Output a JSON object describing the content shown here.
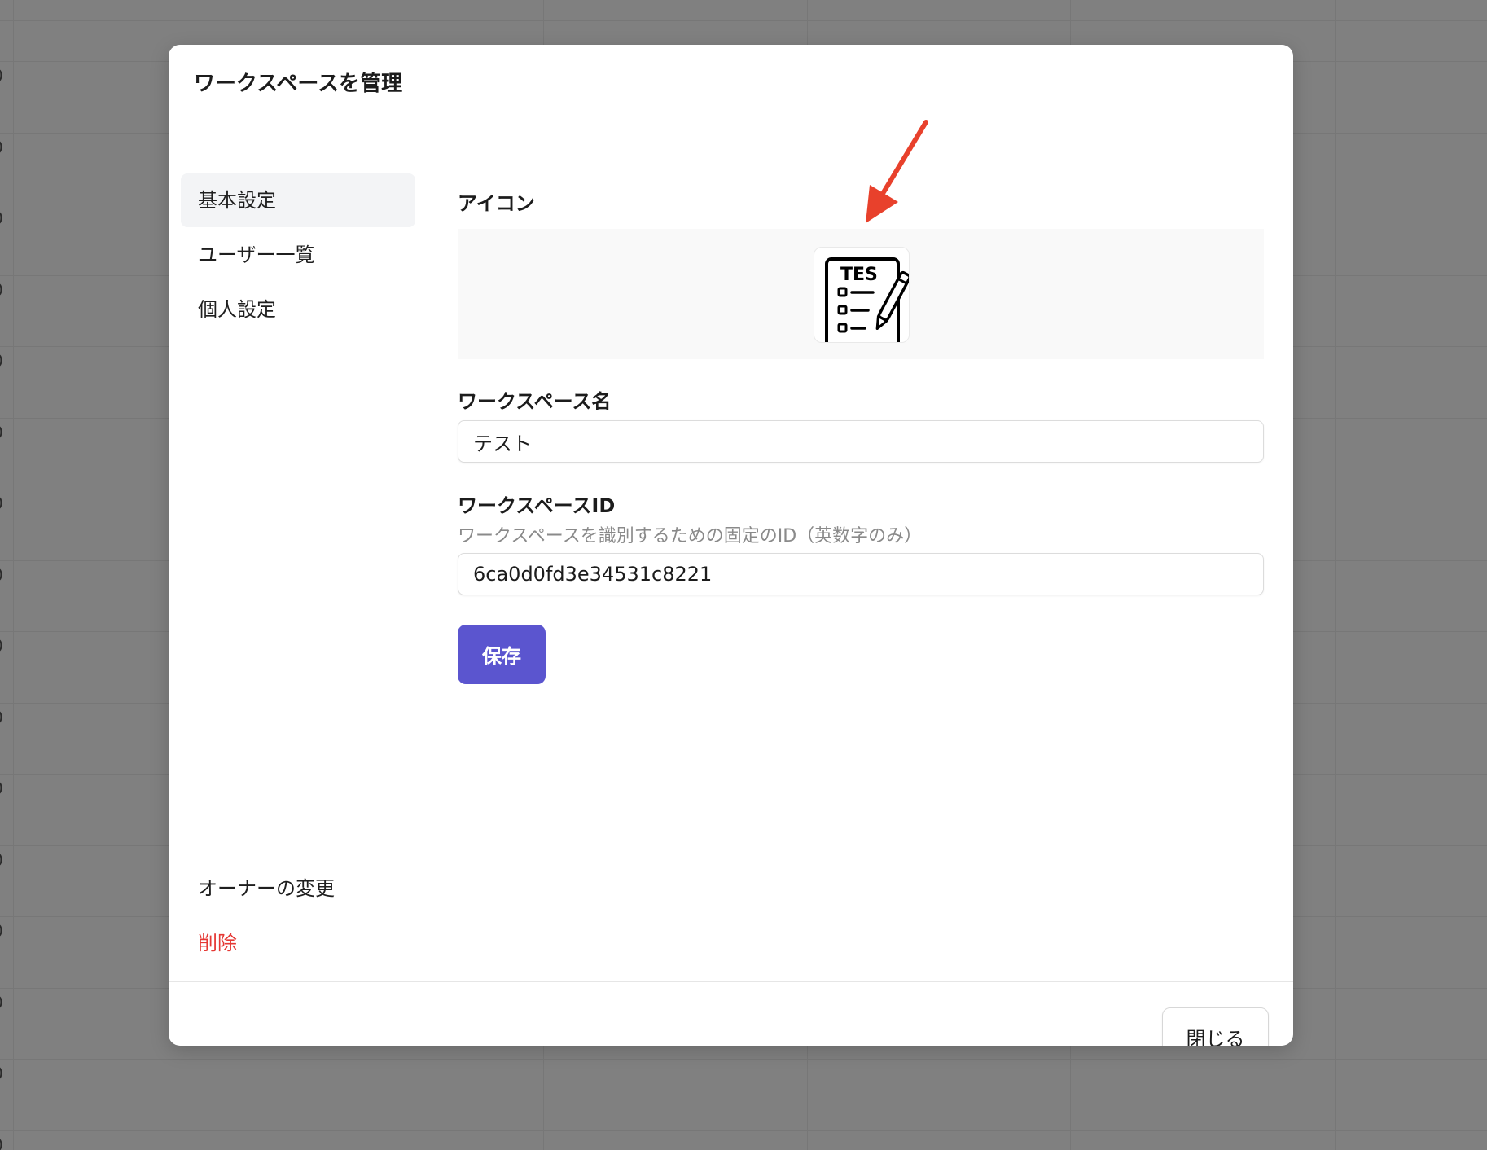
{
  "dialog": {
    "title": "ワークスペースを管理"
  },
  "sidebar": {
    "items": [
      {
        "label": "基本設定",
        "active": true
      },
      {
        "label": "ユーザー一覧"
      },
      {
        "label": "個人設定"
      }
    ],
    "bottom_items": [
      {
        "label": "オーナーの変更"
      },
      {
        "label": "削除",
        "danger": true
      }
    ]
  },
  "form": {
    "icon_label": "アイコン",
    "icon_image": {
      "text": "TES",
      "icon": "test-checklist-pencil-icon"
    },
    "name_label": "ワークスペース名",
    "name_value": "テスト",
    "id_label": "ワークスペースID",
    "id_help": "ワークスペースを識別するための固定のID（英数字のみ）",
    "id_value": "6ca0d0fd3e34531c8221",
    "save_label": "保存"
  },
  "footer": {
    "close_label": "閉じる"
  },
  "colors": {
    "primary": "#5b55cf",
    "danger": "#e53935",
    "annotation": "#e8412c"
  },
  "backdrop_edge_digits": [
    "0",
    "0",
    "0",
    "0",
    "0",
    "0",
    "0",
    "0",
    "0",
    "0",
    "0",
    "0",
    "0",
    "0",
    "0",
    "0"
  ]
}
